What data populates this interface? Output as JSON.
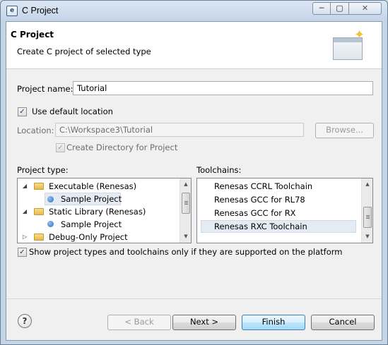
{
  "window": {
    "title": "C Project",
    "app_icon": "eclipse-c-icon",
    "min_glyph": "─",
    "max_glyph": "▢",
    "close_glyph": "✕"
  },
  "banner": {
    "title": "C Project",
    "description": "Create C project of selected type",
    "icon": "new-project-wizard-icon"
  },
  "project_name": {
    "label": "Project name:",
    "value": "Tutorial"
  },
  "use_default_location": {
    "label": "Use default location",
    "checked": true
  },
  "location": {
    "label": "Location:",
    "value": "C:\\Workspace3\\Tutorial",
    "browse_label": "Browse...",
    "enabled": false
  },
  "create_directory": {
    "label": "Create Directory for Project",
    "checked": true,
    "enabled": false
  },
  "project_type": {
    "label": "Project type:",
    "items": [
      {
        "label": "Executable (Renesas)",
        "kind": "folder",
        "expanded": true,
        "level": 0
      },
      {
        "label": "Sample Project",
        "kind": "item",
        "level": 1,
        "selected": true
      },
      {
        "label": "Static Library (Renesas)",
        "kind": "folder",
        "expanded": true,
        "level": 0
      },
      {
        "label": "Sample Project",
        "kind": "item",
        "level": 1
      },
      {
        "label": "Debug-Only Project",
        "kind": "folder",
        "expanded": false,
        "level": 0
      }
    ]
  },
  "toolchains": {
    "label": "Toolchains:",
    "items": [
      {
        "label": "Renesas CCRL Toolchain"
      },
      {
        "label": "Renesas GCC for RL78"
      },
      {
        "label": "Renesas GCC for RX"
      },
      {
        "label": "Renesas RXC Toolchain",
        "selected": true
      }
    ]
  },
  "show_supported": {
    "label": "Show project types and toolchains only if they are supported on the platform",
    "checked": true
  },
  "footer": {
    "help_glyph": "?",
    "back_label": "< Back",
    "back_enabled": false,
    "next_label": "Next >",
    "finish_label": "Finish",
    "cancel_label": "Cancel"
  },
  "glyphs": {
    "check": "✓",
    "expanded": "◢",
    "collapsed": "▷",
    "up": "▲",
    "down": "▼"
  }
}
